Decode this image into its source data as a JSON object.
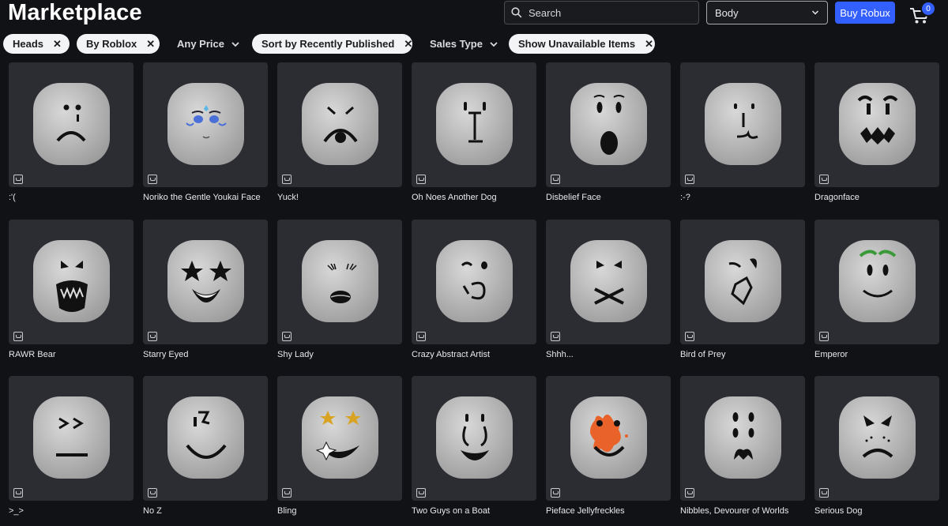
{
  "header": {
    "title": "Marketplace",
    "search_placeholder": "Search",
    "category_selected": "Body",
    "buy_robux_label": "Buy Robux",
    "cart_count": "0"
  },
  "filters": [
    {
      "label": "Heads",
      "type": "removable"
    },
    {
      "label": "By Roblox",
      "type": "removable"
    },
    {
      "label": "Any Price",
      "type": "dropdown"
    },
    {
      "label": "Sort by Recently Published",
      "type": "removable"
    },
    {
      "label": "Sales Type",
      "type": "dropdown"
    },
    {
      "label": "Show Unavailable Items",
      "type": "removable"
    }
  ],
  "items": [
    {
      "name": ":'("
    },
    {
      "name": "Noriko the Gentle Youkai Face"
    },
    {
      "name": "Yuck!"
    },
    {
      "name": "Oh Noes Another Dog"
    },
    {
      "name": "Disbelief Face"
    },
    {
      "name": ":-?"
    },
    {
      "name": "Dragonface"
    },
    {
      "name": "RAWR Bear"
    },
    {
      "name": "Starry Eyed"
    },
    {
      "name": "Shy Lady"
    },
    {
      "name": "Crazy Abstract Artist"
    },
    {
      "name": "Shhh..."
    },
    {
      "name": "Bird of Prey"
    },
    {
      "name": "Emperor"
    },
    {
      "name": ">_>"
    },
    {
      "name": "No Z"
    },
    {
      "name": "Bling"
    },
    {
      "name": "Two Guys on a Boat"
    },
    {
      "name": "Pieface Jellyfreckles"
    },
    {
      "name": "Nibbles, Devourer of Worlds"
    },
    {
      "name": "Serious Dog"
    }
  ],
  "colors": {
    "background": "#111216",
    "card": "#2b2d33",
    "accent": "#335fff",
    "head": "#c9c9c9"
  }
}
